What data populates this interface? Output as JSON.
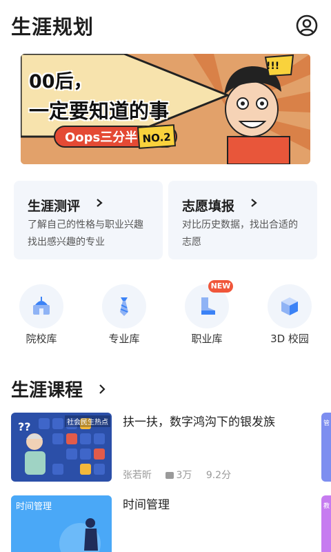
{
  "header": {
    "title": "生涯规划",
    "user_icon": "user-circle-icon"
  },
  "banner": {
    "line1": "00后，",
    "line2": "一定要知道的事",
    "pill": "Oops三分半",
    "no": "NO.2",
    "badge": "!!!"
  },
  "cards": [
    {
      "title": "生涯测评",
      "desc": "了解自己的性格与职业兴趣找出感兴趣的专业"
    },
    {
      "title": "志愿填报",
      "desc": "对比历史数据，找出合适的志愿"
    }
  ],
  "quick_links": [
    {
      "label": "院校库",
      "icon": "school-icon"
    },
    {
      "label": "专业库",
      "icon": "tie-icon"
    },
    {
      "label": "职业库",
      "icon": "boot-icon",
      "badge": "NEW"
    },
    {
      "label": "3D 校园",
      "icon": "cube-icon"
    }
  ],
  "courses": {
    "heading": "生涯课程",
    "items": [
      {
        "title": "扶一扶，数字鸿沟下的银发族",
        "thumb_tag": "社会民生热点",
        "author": "张若昕",
        "views": "3万",
        "score": "9.2分",
        "peek_tag": "管"
      },
      {
        "title": "时间管理",
        "thumb_tag": "时间管理",
        "peek_tag": "教"
      }
    ]
  },
  "colors": {
    "accent_blue": "#3b82f6",
    "badge_red": "#f0563a",
    "card_bg": "#f3f6fb"
  }
}
